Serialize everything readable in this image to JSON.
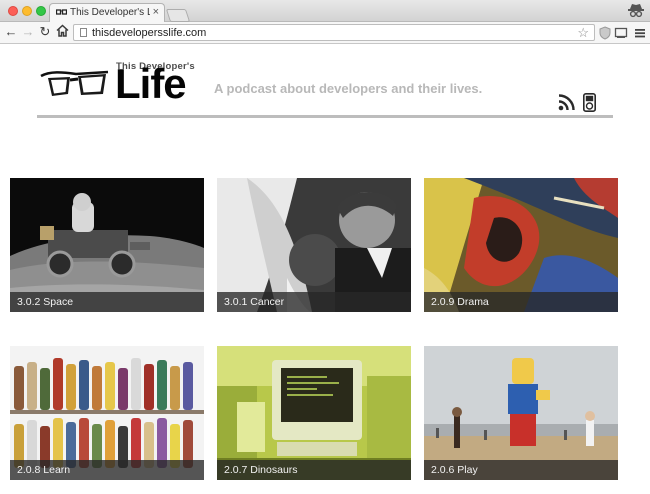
{
  "browser": {
    "tab_title": "This Developer's Life - Stor",
    "tab_close": "×",
    "url": "thisdevelopersslife.com",
    "star": "☆"
  },
  "site": {
    "logo_small": "This Developer's",
    "logo_big": "Life",
    "tagline": "A podcast about developers and their lives."
  },
  "episodes": [
    {
      "label": "3.0.2 Space"
    },
    {
      "label": "3.0.1 Cancer"
    },
    {
      "label": "2.0.9 Drama"
    },
    {
      "label": "2.0.8 Learn"
    },
    {
      "label": "2.0.7 Dinosaurs"
    },
    {
      "label": "2.0.6 Play"
    }
  ],
  "colors": {
    "rule": "#bdbdbd",
    "tagline": "#b8b8b8",
    "caption_bg": "rgba(40,40,40,0.78)"
  },
  "icons": [
    "back-icon",
    "forward-icon",
    "reload-icon",
    "home-icon",
    "page-icon",
    "star-icon",
    "shield-icon",
    "cast-icon",
    "menu-icon",
    "rss-icon",
    "ipod-icon",
    "glasses-logo"
  ]
}
